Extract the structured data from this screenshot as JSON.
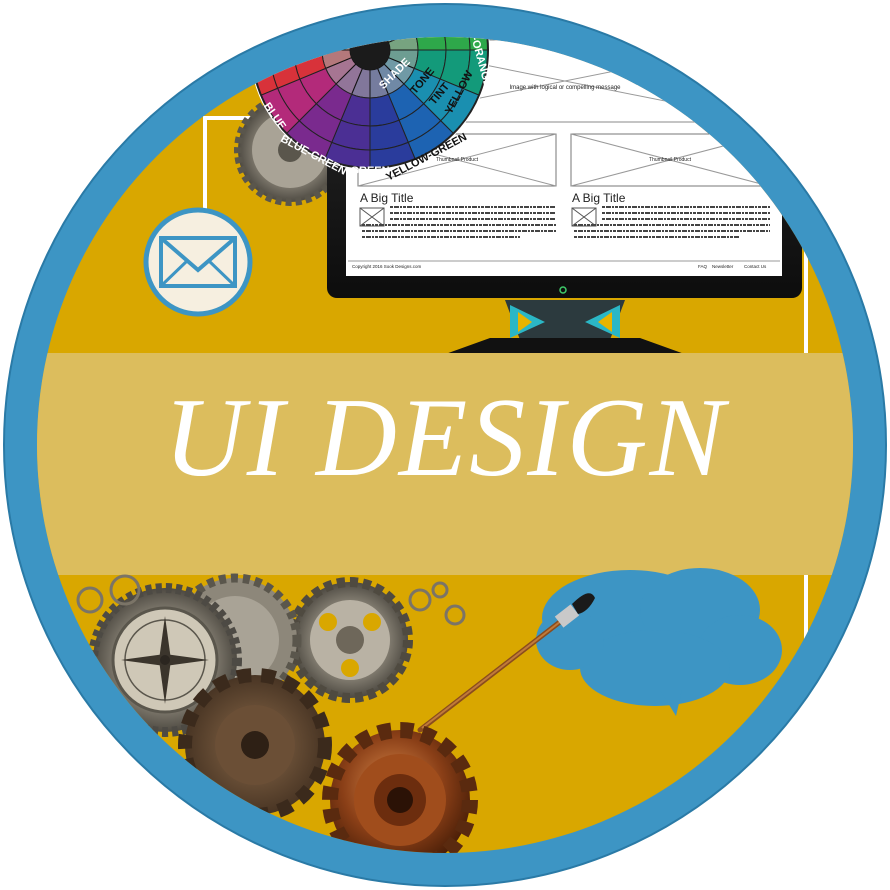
{
  "banner": {
    "title": "UI DESIGN"
  },
  "color_wheel": {
    "labels": [
      "YELLOW-ORANGE",
      "YELLOW",
      "TINT",
      "TONE",
      "SHADE",
      "YELLOW-GREEN",
      "GREEN",
      "BLUE-GREEN",
      "BLUE"
    ],
    "colors": {
      "yellow": "#f7e11b",
      "orange": "#f39a1d",
      "green": "#1f8a2e",
      "blue": "#1e3fa6",
      "purple": "#5b2d94"
    }
  },
  "monitor": {
    "hero_caption": "Image with logical or compelling message",
    "cards": [
      {
        "image_caption": "Thumbnail Product",
        "title": "A Big Title"
      },
      {
        "image_caption": "Thumbnail Product",
        "title": "A Big Title"
      }
    ],
    "footer": {
      "copyright": "Copyright 2016 Sook Designs.com",
      "links": [
        "FAQ",
        "Newsletter",
        "Contact Us"
      ]
    }
  },
  "palette": {
    "ring": "#3d95c4",
    "background": "#d9a700",
    "banner": "#dcbd5d",
    "cloud": "#3d95c4",
    "envelope_bg": "#f6efe0"
  },
  "icons": [
    "envelope-icon",
    "paintbrush-icon",
    "speech-cloud-icon",
    "gear-icon",
    "compass-icon"
  ]
}
